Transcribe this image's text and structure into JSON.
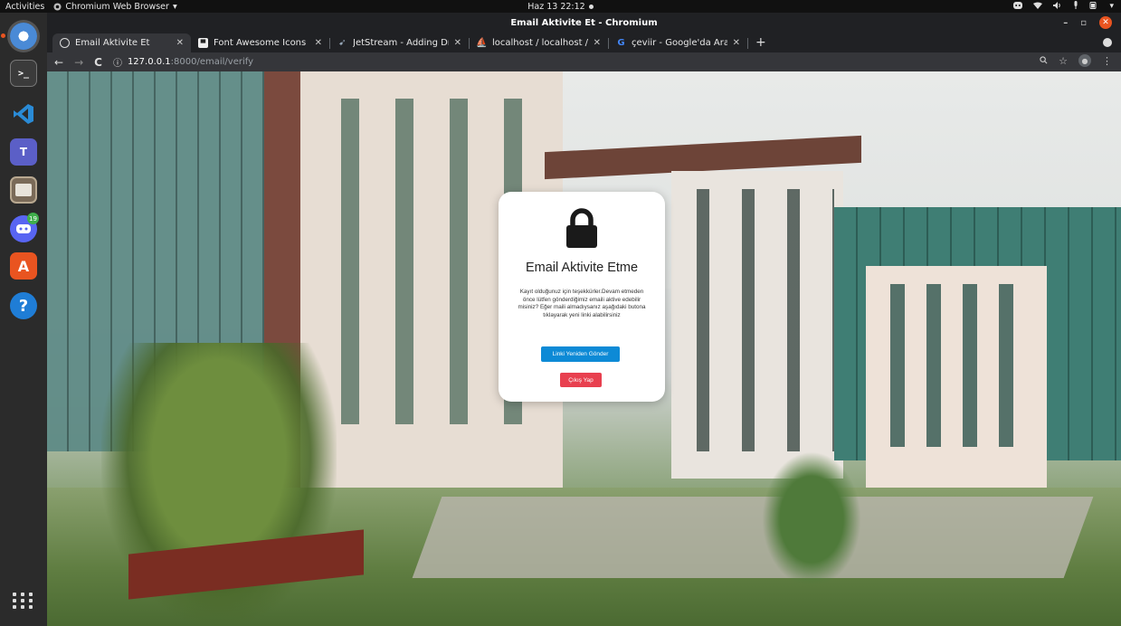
{
  "topbar": {
    "activities": "Activities",
    "app_name": "Chromium Web Browser",
    "clock": "Haz 13  22:12"
  },
  "window": {
    "title": "Email Aktivite Et - Chromium"
  },
  "tabs": [
    {
      "title": "Email Aktivite Et",
      "icon": "chromium-favicon",
      "active": true
    },
    {
      "title": "Font Awesome Icons",
      "icon": "font-awesome-favicon",
      "active": false
    },
    {
      "title": "JetStream - Adding Dropd",
      "icon": "jetstream-favicon",
      "active": false
    },
    {
      "title": "localhost / localhost / dev",
      "icon": "phpmyadmin-favicon",
      "active": false
    },
    {
      "title": "çeviir - Google'da Ara",
      "icon": "google-favicon",
      "active": false
    }
  ],
  "toolbar": {
    "url_host": "127.0.0.1",
    "url_path": ":8000/email/verify"
  },
  "dock": {
    "discord_badge": "19"
  },
  "card": {
    "title": "Email Aktivite Etme",
    "text": "Kayıt olduğunuz için teşekkürler.Devam etmeden önce lütfen gönderdiğimiz emaili aktive edebilir misiniz? Eğer maili almadıysanız aşağıdaki butona tıklayarak yeni linki alabilirsiniz",
    "resend_label": "Linki Yeniden Gönder",
    "logout_label": "Çıkış Yap"
  },
  "colors": {
    "resend_button": "#0d8ad6",
    "logout_button": "#e8404f",
    "ubuntu_accent": "#e95420"
  }
}
